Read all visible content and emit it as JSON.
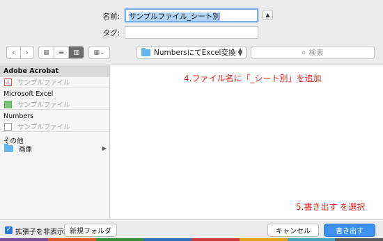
{
  "form": {
    "name_label": "名前:",
    "name_value": "サンプルファイル_シート別",
    "tag_label": "タグ:",
    "collapse_icon": "chevron-up-icon"
  },
  "toolbar": {
    "back_icon": "chevron-left-icon",
    "forward_icon": "chevron-right-icon",
    "icon_view_icon": "grid-icon",
    "list_view_icon": "list-icon",
    "column_view_icon": "columns-icon",
    "gallery_view_icon": "gallery-icon",
    "location": "NumbersにてExcel変換",
    "search_placeholder": "検索"
  },
  "sidebar": {
    "sections": [
      {
        "header": "Adobe Acrobat",
        "items": [
          {
            "label": "サンプルファイル",
            "icon": "pdf-icon"
          }
        ]
      },
      {
        "header": "Microsoft Excel",
        "items": [
          {
            "label": "サンプルファイル",
            "icon": "excel-icon"
          }
        ]
      },
      {
        "header": "Numbers",
        "items": [
          {
            "label": "サンプルファイル",
            "icon": "numbers-icon"
          }
        ]
      },
      {
        "header": "その他",
        "items": [
          {
            "label": "画像",
            "icon": "folder-icon"
          }
        ]
      }
    ]
  },
  "annotations": {
    "step4": "4.ファイル名に「_シート別」を追加",
    "step5": "5.書き出す を選択"
  },
  "bottom": {
    "hide_ext_label": "拡張子を非表示",
    "new_folder": "新規フォルダ",
    "cancel": "キャンセル",
    "export": "書き出す"
  },
  "colors": {
    "accent": "#3d8ff0",
    "annotation": "#e0201a",
    "focus_ring": "#7ab1ea"
  }
}
